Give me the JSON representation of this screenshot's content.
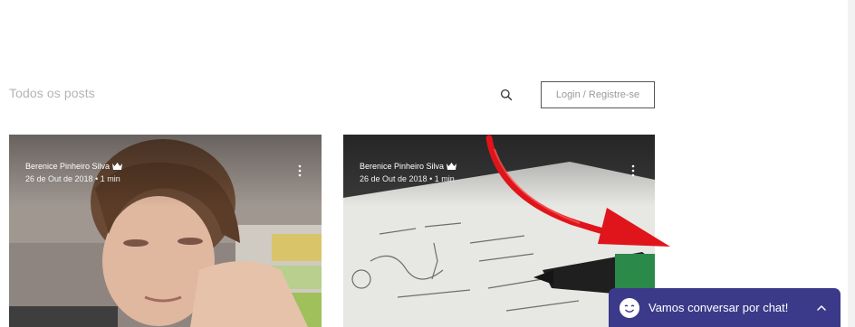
{
  "header": {
    "filter_label": "Todos os posts",
    "login_label": "Login / Registre-se"
  },
  "icons": {
    "search": "search-icon",
    "more": "more-vertical-icon",
    "crown": "crown-icon",
    "chat": "smiley-icon",
    "toggle": "chevron-up-icon"
  },
  "posts": [
    {
      "author": "Berenice Pinheiro Silva",
      "date": "26 de Out de 2018",
      "read_time": "1 min"
    },
    {
      "author": "Berenice Pinheiro Silva",
      "date": "26 de Out de 2018",
      "read_time": "1 min"
    }
  ],
  "chat": {
    "label": "Vamos conversar por chat!"
  },
  "colors": {
    "chat_background": "#3b3a8a",
    "annotation_arrow": "#e0141b"
  }
}
